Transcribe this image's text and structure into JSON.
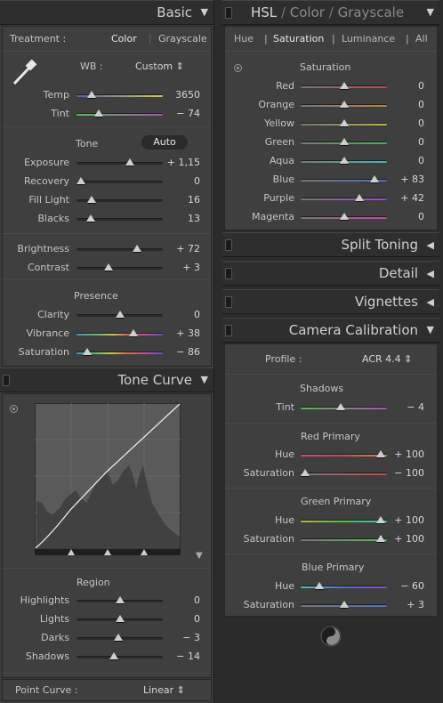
{
  "basic": {
    "title": "Basic",
    "treatment_label": "Treatment :",
    "color_btn": "Color",
    "grayscale_btn": "Grayscale",
    "wb_label": "WB :",
    "wb_value": "Custom",
    "rows": [
      {
        "label": "Temp",
        "value": "3650",
        "pos": 0.18,
        "kind": "temp"
      },
      {
        "label": "Tint",
        "value": "− 74",
        "pos": 0.26,
        "kind": "tint"
      }
    ],
    "tone_label": "Tone",
    "auto_btn": "Auto",
    "tone_rows": [
      {
        "label": "Exposure",
        "value": "+ 1,15",
        "pos": 0.62
      },
      {
        "label": "Recovery",
        "value": "0",
        "pos": 0.05
      },
      {
        "label": "Fill Light",
        "value": "16",
        "pos": 0.18
      },
      {
        "label": "Blacks",
        "value": "13",
        "pos": 0.16
      }
    ],
    "bc_rows": [
      {
        "label": "Brightness",
        "value": "+ 72",
        "pos": 0.7
      },
      {
        "label": "Contrast",
        "value": "+ 3",
        "pos": 0.37
      }
    ],
    "presence_label": "Presence",
    "presence_rows": [
      {
        "label": "Clarity",
        "value": "0",
        "pos": 0.5,
        "kind": "plain"
      },
      {
        "label": "Vibrance",
        "value": "+ 38",
        "pos": 0.66,
        "kind": "rainbow"
      },
      {
        "label": "Saturation",
        "value": "− 86",
        "pos": 0.12,
        "kind": "rainbow"
      }
    ]
  },
  "tone_curve": {
    "title": "Tone Curve",
    "region_label": "Region",
    "rows": [
      {
        "label": "Highlights",
        "value": "0",
        "pos": 0.5
      },
      {
        "label": "Lights",
        "value": "0",
        "pos": 0.5
      },
      {
        "label": "Darks",
        "value": "− 3",
        "pos": 0.48
      },
      {
        "label": "Shadows",
        "value": "− 14",
        "pos": 0.43
      }
    ],
    "point_curve_label": "Point Curve :",
    "point_curve_value": "Linear"
  },
  "hsl": {
    "title_hsl": "HSL",
    "title_color": "Color",
    "title_gray": "Grayscale",
    "tabs": [
      "Hue",
      "Saturation",
      "Luminance",
      "All"
    ],
    "section_label": "Saturation",
    "rows": [
      {
        "label": "Red",
        "value": "0",
        "pos": 0.5,
        "c": "#c24a4a"
      },
      {
        "label": "Orange",
        "value": "0",
        "pos": 0.5,
        "c": "#c2804a"
      },
      {
        "label": "Yellow",
        "value": "0",
        "pos": 0.5,
        "c": "#bdb44a"
      },
      {
        "label": "Green",
        "value": "0",
        "pos": 0.5,
        "c": "#4ab25a"
      },
      {
        "label": "Aqua",
        "value": "0",
        "pos": 0.5,
        "c": "#4ab6b0"
      },
      {
        "label": "Blue",
        "value": "+ 83",
        "pos": 0.86,
        "c": "#4a6ec2"
      },
      {
        "label": "Purple",
        "value": "+ 42",
        "pos": 0.68,
        "c": "#9a4ac2"
      },
      {
        "label": "Magenta",
        "value": "0",
        "pos": 0.5,
        "c": "#c24aa8"
      }
    ]
  },
  "split_toning": {
    "title": "Split Toning"
  },
  "detail": {
    "title": "Detail"
  },
  "vignettes": {
    "title": "Vignettes"
  },
  "camera_calibration": {
    "title": "Camera Calibration",
    "profile_label": "Profile :",
    "profile_value": "ACR 4.4",
    "shadows_label": "Shadows",
    "tint": {
      "label": "Tint",
      "value": "− 4",
      "pos": 0.46
    },
    "red_label": "Red Primary",
    "red": [
      {
        "label": "Hue",
        "value": "+ 100",
        "pos": 0.93,
        "kind": "redhue"
      },
      {
        "label": "Saturation",
        "value": "− 100",
        "pos": 0.05,
        "kind": "redsat"
      }
    ],
    "green_label": "Green Primary",
    "green": [
      {
        "label": "Hue",
        "value": "+ 100",
        "pos": 0.93,
        "kind": "greenhue"
      },
      {
        "label": "Saturation",
        "value": "+ 100",
        "pos": 0.93,
        "kind": "greensat"
      }
    ],
    "blue_label": "Blue Primary",
    "blue": [
      {
        "label": "Hue",
        "value": "− 60",
        "pos": 0.22,
        "kind": "bluehue"
      },
      {
        "label": "Saturation",
        "value": "+ 3",
        "pos": 0.51,
        "kind": "bluesat"
      }
    ]
  }
}
